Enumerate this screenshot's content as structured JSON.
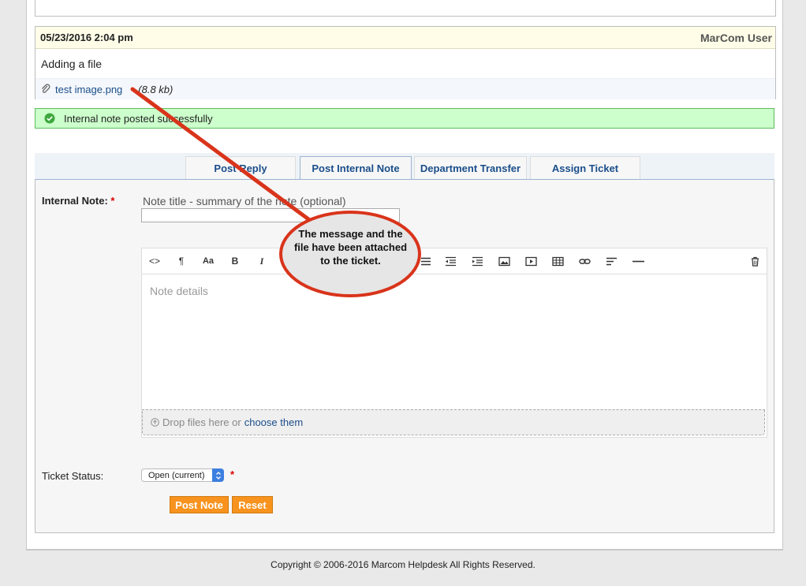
{
  "thread": {
    "date": "05/23/2016 2:04 pm",
    "user": "MarCom User",
    "message": "Adding a file",
    "attachment_name": "test image.png",
    "attachment_size": "(8.8 kb)"
  },
  "notice": {
    "text": "Internal note posted successfully"
  },
  "tabs": [
    {
      "label": "Post Reply",
      "active": false
    },
    {
      "label": "Post Internal Note",
      "active": true
    },
    {
      "label": "Department Transfer",
      "active": false
    },
    {
      "label": "Assign Ticket",
      "active": false
    }
  ],
  "form": {
    "note_label": "Internal Note:",
    "required_mark": "*",
    "title_hint": "Note title - summary of the note (optional)",
    "title_value": "",
    "editor_placeholder": "Note details",
    "toolbar_icons": [
      "code-icon",
      "paragraph-icon",
      "font-size-icon",
      "bold-icon",
      "italic-icon",
      "unordered-list-icon",
      "outdent-icon",
      "indent-icon",
      "image-icon",
      "video-icon",
      "table-icon",
      "link-icon",
      "align-left-icon",
      "horizontal-rule-icon",
      "trash-icon"
    ],
    "toolbar_text": {
      "code": "<>",
      "paragraph": "¶",
      "font_size": "Aa",
      "bold": "B",
      "italic": "I"
    },
    "dropzone_text": "Drop files here or",
    "dropzone_link": "choose them",
    "status_label": "Ticket Status:",
    "status_value": "Open (current)",
    "post_button": "Post Note",
    "reset_button": "Reset"
  },
  "callout": {
    "text": "The message and the file have been attached to the ticket.",
    "color": "#d9341b"
  },
  "footer": {
    "copyright": "Copyright © 2006-2016 Marcom Helpdesk All Rights Reserved."
  }
}
